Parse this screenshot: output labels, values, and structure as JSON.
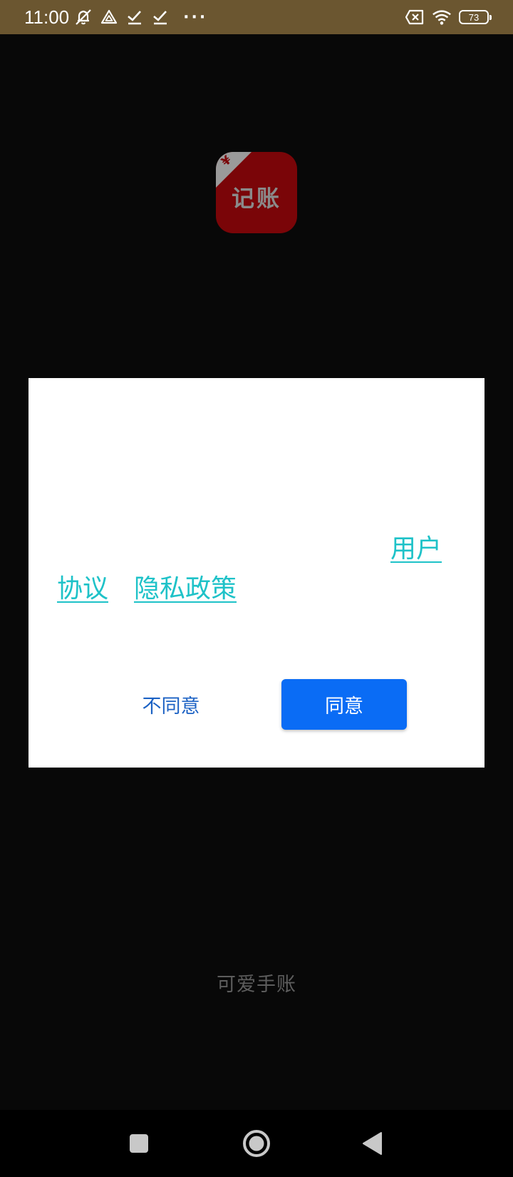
{
  "status_bar": {
    "time": "11:00",
    "dots": "···",
    "battery": "73",
    "icons": [
      "silent-bell-icon",
      "drive-icon",
      "check-icon",
      "check-icon",
      "sim-off-icon",
      "wifi-icon",
      "battery-icon"
    ]
  },
  "app_icon": {
    "symbol": "¥",
    "text": "记账",
    "color": "#7a0508"
  },
  "dialog": {
    "links": {
      "user": "用户",
      "agreement": "协议",
      "privacy": "隐私政策"
    },
    "disagree_label": "不同意",
    "agree_label": "同意",
    "link_color": "#1ec2c8",
    "accent": "#0a6cf5"
  },
  "app_name": "可爱手账",
  "nav_bar": {
    "icons": [
      "recents-icon",
      "home-icon",
      "back-icon"
    ]
  }
}
